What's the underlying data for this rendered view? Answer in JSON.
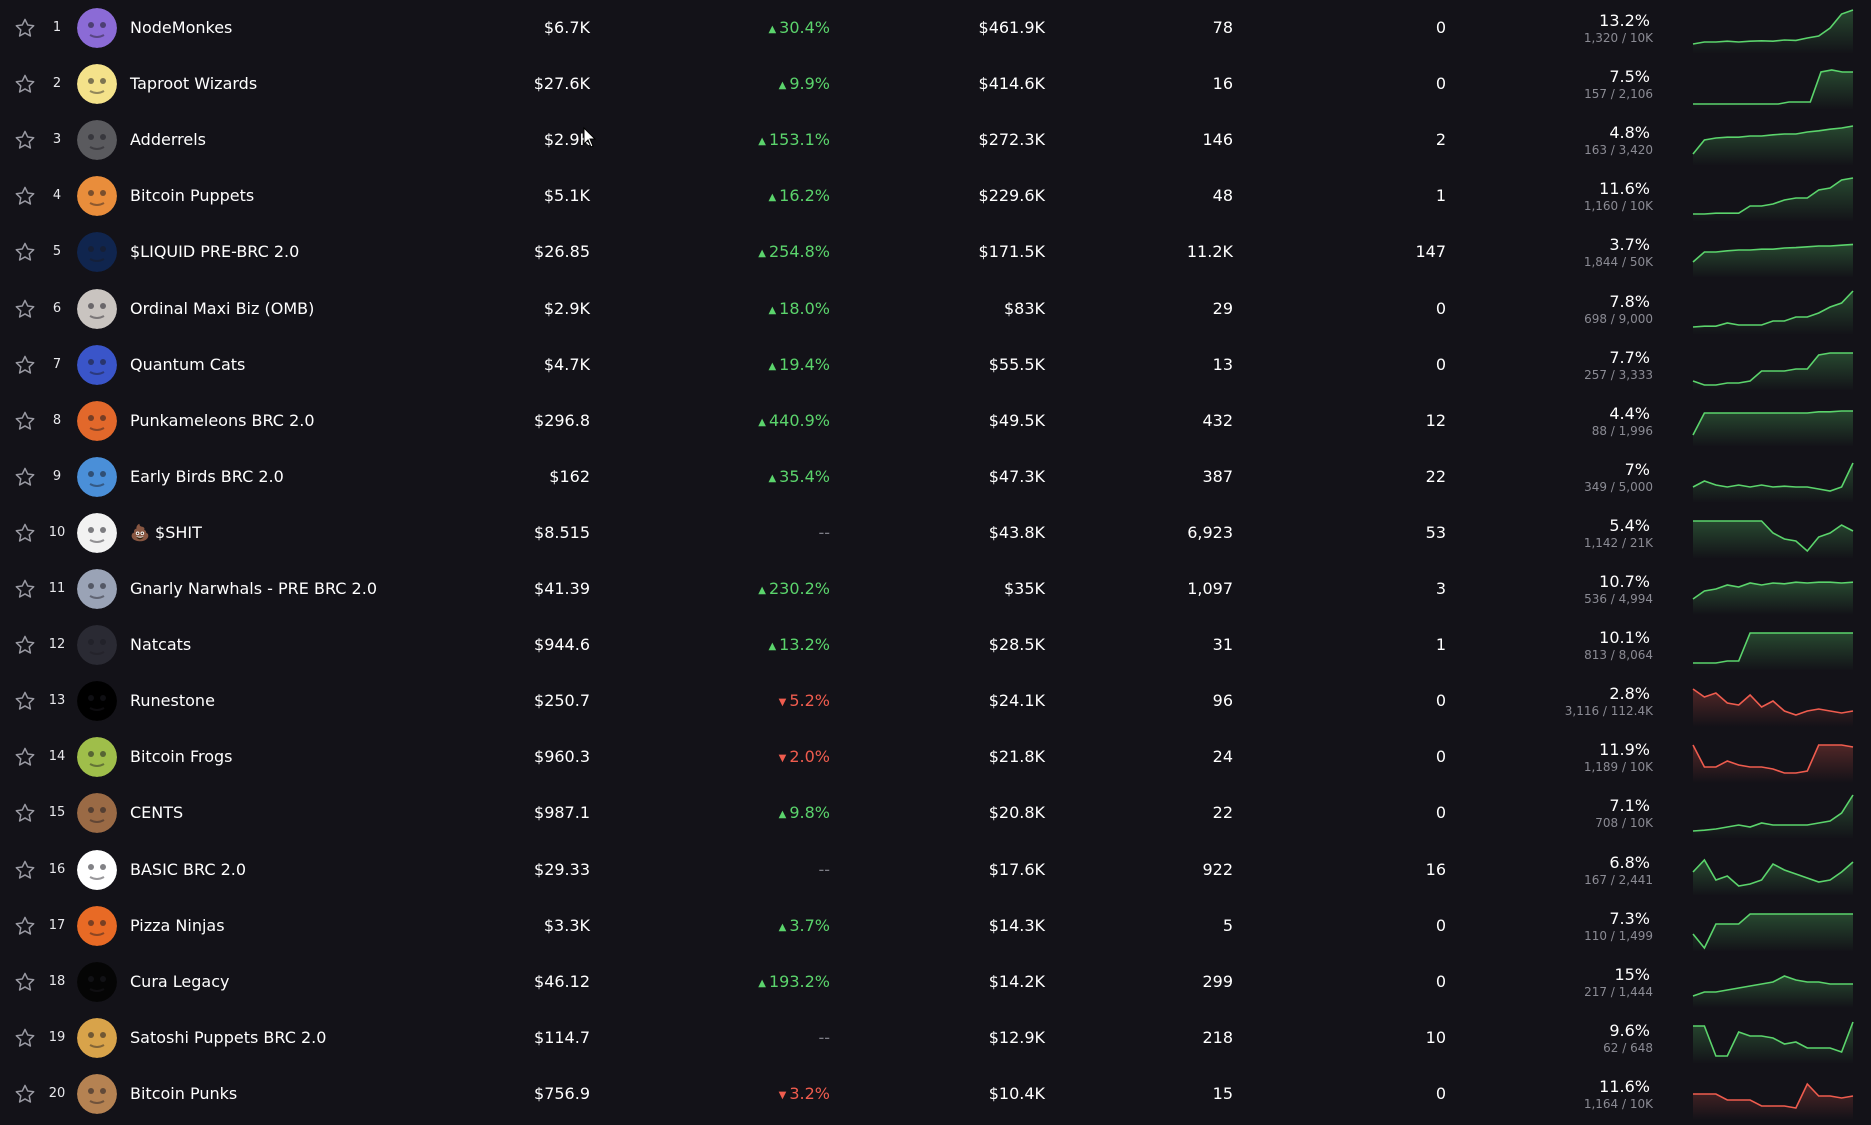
{
  "colors": {
    "background": "#131218",
    "positive": "#5bd46c",
    "negative": "#ef5c4e",
    "neutral": "#7d7d86",
    "muted_text": "#8b8b94"
  },
  "icons": {
    "favorite": "star-outline-icon",
    "change_up": "triangle-up-icon",
    "change_down": "triangle-down-icon",
    "cursor": "mouse-pointer-icon"
  },
  "rows": [
    {
      "rank": "1",
      "name": "NodeMonkes",
      "price": "$6.7K",
      "change": "30.4%",
      "dir": "up",
      "volume": "$461.9K",
      "sales": "78",
      "listed": "0",
      "pct": "13.2%",
      "pct_sub": "1,320 / 10K",
      "avatar": "#8b6bd6",
      "spark": [
        0.15,
        0.2,
        0.2,
        0.22,
        0.2,
        0.22,
        0.23,
        0.22,
        0.25,
        0.24,
        0.3,
        0.35,
        0.55,
        0.9,
        1.0
      ],
      "spark_dir": "up"
    },
    {
      "rank": "2",
      "name": "Taproot Wizards",
      "price": "$27.6K",
      "change": "9.9%",
      "dir": "up",
      "volume": "$414.6K",
      "sales": "16",
      "listed": "0",
      "pct": "7.5%",
      "pct_sub": "157 / 2,106",
      "avatar": "#f4e28a",
      "spark": [
        0.05,
        0.05,
        0.05,
        0.05,
        0.05,
        0.05,
        0.05,
        0.05,
        0.05,
        0.1,
        0.1,
        0.1,
        0.85,
        0.9,
        0.85,
        0.85
      ],
      "spark_dir": "up"
    },
    {
      "rank": "3",
      "name": "Adderrels",
      "price": "$2.9K",
      "change": "153.1%",
      "dir": "up",
      "volume": "$272.3K",
      "sales": "146",
      "listed": "2",
      "pct": "4.8%",
      "pct_sub": "163 / 3,420",
      "avatar": "#5a5a5e",
      "spark": [
        0.2,
        0.55,
        0.6,
        0.62,
        0.62,
        0.65,
        0.65,
        0.68,
        0.7,
        0.7,
        0.75,
        0.78,
        0.82,
        0.85,
        0.9
      ],
      "spark_dir": "up"
    },
    {
      "rank": "4",
      "name": "Bitcoin Puppets",
      "price": "$5.1K",
      "change": "16.2%",
      "dir": "up",
      "volume": "$229.6K",
      "sales": "48",
      "listed": "1",
      "pct": "11.6%",
      "pct_sub": "1,160 / 10K",
      "avatar": "#e98d3b",
      "spark": [
        0.1,
        0.1,
        0.12,
        0.12,
        0.12,
        0.3,
        0.3,
        0.35,
        0.45,
        0.5,
        0.5,
        0.7,
        0.75,
        0.95,
        1.0
      ],
      "spark_dir": "up"
    },
    {
      "rank": "5",
      "name": "$LIQUID PRE-BRC 2.0",
      "price": "$26.85",
      "change": "254.8%",
      "dir": "up",
      "volume": "$171.5K",
      "sales": "11.2K",
      "listed": "147",
      "pct": "3.7%",
      "pct_sub": "1,844 / 50K",
      "avatar": "#10254e",
      "spark": [
        0.3,
        0.55,
        0.55,
        0.58,
        0.6,
        0.6,
        0.62,
        0.62,
        0.65,
        0.66,
        0.68,
        0.7,
        0.7,
        0.72,
        0.74
      ],
      "spark_dir": "up"
    },
    {
      "rank": "6",
      "name": "Ordinal Maxi Biz (OMB)",
      "price": "$2.9K",
      "change": "18.0%",
      "dir": "up",
      "volume": "$83K",
      "sales": "29",
      "listed": "0",
      "pct": "7.8%",
      "pct_sub": "698 / 9,000",
      "avatar": "#c9c4c0",
      "spark": [
        0.1,
        0.12,
        0.12,
        0.2,
        0.15,
        0.15,
        0.15,
        0.25,
        0.25,
        0.35,
        0.35,
        0.45,
        0.6,
        0.7,
        1.0
      ],
      "spark_dir": "up"
    },
    {
      "rank": "7",
      "name": "Quantum Cats",
      "price": "$4.7K",
      "change": "19.4%",
      "dir": "up",
      "volume": "$55.5K",
      "sales": "13",
      "listed": "0",
      "pct": "7.7%",
      "pct_sub": "257 / 3,333",
      "avatar": "#3a55c9",
      "spark": [
        0.15,
        0.05,
        0.05,
        0.1,
        0.1,
        0.15,
        0.4,
        0.4,
        0.4,
        0.45,
        0.45,
        0.8,
        0.85,
        0.85,
        0.85
      ],
      "spark_dir": "up"
    },
    {
      "rank": "8",
      "name": "Punkameleons BRC 2.0",
      "price": "$296.8",
      "change": "440.9%",
      "dir": "up",
      "volume": "$49.5K",
      "sales": "432",
      "listed": "12",
      "pct": "4.4%",
      "pct_sub": "88 / 1,996",
      "avatar": "#e2682b",
      "spark": [
        0.2,
        0.75,
        0.75,
        0.75,
        0.75,
        0.75,
        0.75,
        0.75,
        0.75,
        0.75,
        0.75,
        0.78,
        0.78,
        0.8,
        0.8
      ],
      "spark_dir": "up"
    },
    {
      "rank": "9",
      "name": "Early Birds BRC 2.0",
      "price": "$162",
      "change": "35.4%",
      "dir": "up",
      "volume": "$47.3K",
      "sales": "387",
      "listed": "22",
      "pct": "7%",
      "pct_sub": "349 / 5,000",
      "avatar": "#4a8fd8",
      "spark": [
        0.3,
        0.45,
        0.35,
        0.3,
        0.35,
        0.3,
        0.35,
        0.3,
        0.32,
        0.3,
        0.3,
        0.25,
        0.2,
        0.3,
        0.9
      ],
      "spark_dir": "up"
    },
    {
      "rank": "10",
      "name": "💩 $SHIT",
      "price": "$8.515",
      "change": "--",
      "dir": "flat",
      "volume": "$43.8K",
      "sales": "6,923",
      "listed": "53",
      "pct": "5.4%",
      "pct_sub": "1,142 / 21K",
      "avatar": "#f2f2f2",
      "spark": [
        0.85,
        0.85,
        0.85,
        0.85,
        0.85,
        0.85,
        0.85,
        0.55,
        0.4,
        0.35,
        0.1,
        0.45,
        0.55,
        0.75,
        0.6
      ],
      "spark_dir": "up"
    },
    {
      "rank": "11",
      "name": "Gnarly Narwhals - PRE BRC 2.0",
      "price": "$41.39",
      "change": "230.2%",
      "dir": "up",
      "volume": "$35K",
      "sales": "1,097",
      "listed": "3",
      "pct": "10.7%",
      "pct_sub": "536 / 4,994",
      "avatar": "#9aa3b6",
      "spark": [
        0.3,
        0.5,
        0.55,
        0.65,
        0.6,
        0.7,
        0.65,
        0.7,
        0.68,
        0.72,
        0.7,
        0.72,
        0.72,
        0.7,
        0.72
      ],
      "spark_dir": "up"
    },
    {
      "rank": "12",
      "name": "Natcats",
      "price": "$944.6",
      "change": "13.2%",
      "dir": "up",
      "volume": "$28.5K",
      "sales": "31",
      "listed": "1",
      "pct": "10.1%",
      "pct_sub": "813 / 8,064",
      "avatar": "#2a2a33",
      "spark": [
        0.1,
        0.1,
        0.1,
        0.15,
        0.15,
        0.85,
        0.85,
        0.85,
        0.85,
        0.85,
        0.85,
        0.85,
        0.85,
        0.85,
        0.85
      ],
      "spark_dir": "up"
    },
    {
      "rank": "13",
      "name": "Runestone",
      "price": "$250.7",
      "change": "5.2%",
      "dir": "down",
      "volume": "$24.1K",
      "sales": "96",
      "listed": "0",
      "pct": "2.8%",
      "pct_sub": "3,116 / 112.4K",
      "avatar": "#000000",
      "spark": [
        0.85,
        0.65,
        0.75,
        0.5,
        0.45,
        0.7,
        0.4,
        0.55,
        0.3,
        0.2,
        0.3,
        0.35,
        0.3,
        0.25,
        0.3
      ],
      "spark_dir": "down"
    },
    {
      "rank": "14",
      "name": "Bitcoin Frogs",
      "price": "$960.3",
      "change": "2.0%",
      "dir": "down",
      "volume": "$21.8K",
      "sales": "24",
      "listed": "0",
      "pct": "11.9%",
      "pct_sub": "1,189 / 10K",
      "avatar": "#9fbe4a",
      "spark": [
        0.85,
        0.3,
        0.3,
        0.45,
        0.35,
        0.3,
        0.3,
        0.25,
        0.15,
        0.15,
        0.2,
        0.85,
        0.85,
        0.85,
        0.8
      ],
      "spark_dir": "down"
    },
    {
      "rank": "15",
      "name": "CENTS",
      "price": "$987.1",
      "change": "9.8%",
      "dir": "up",
      "volume": "$20.8K",
      "sales": "22",
      "listed": "0",
      "pct": "7.1%",
      "pct_sub": "708 / 10K",
      "avatar": "#9a6a45",
      "spark": [
        0.1,
        0.12,
        0.15,
        0.2,
        0.25,
        0.2,
        0.3,
        0.25,
        0.25,
        0.25,
        0.25,
        0.3,
        0.35,
        0.55,
        1.0
      ],
      "spark_dir": "up"
    },
    {
      "rank": "16",
      "name": "BASIC BRC 2.0",
      "price": "$29.33",
      "change": "--",
      "dir": "flat",
      "volume": "$17.6K",
      "sales": "922",
      "listed": "16",
      "pct": "6.8%",
      "pct_sub": "167 / 2,441",
      "avatar": "#ffffff",
      "spark": [
        0.5,
        0.8,
        0.3,
        0.4,
        0.15,
        0.2,
        0.3,
        0.7,
        0.55,
        0.45,
        0.35,
        0.25,
        0.3,
        0.5,
        0.75
      ],
      "spark_dir": "up"
    },
    {
      "rank": "17",
      "name": "Pizza Ninjas",
      "price": "$3.3K",
      "change": "3.7%",
      "dir": "up",
      "volume": "$14.3K",
      "sales": "5",
      "listed": "0",
      "pct": "7.3%",
      "pct_sub": "110 / 1,499",
      "avatar": "#e86a25",
      "spark": [
        0.35,
        0.0,
        0.6,
        0.6,
        0.6,
        0.85,
        0.85,
        0.85,
        0.85,
        0.85,
        0.85,
        0.85,
        0.85,
        0.85,
        0.85
      ],
      "spark_dir": "up"
    },
    {
      "rank": "18",
      "name": "Cura Legacy",
      "price": "$46.12",
      "change": "193.2%",
      "dir": "up",
      "volume": "$14.2K",
      "sales": "299",
      "listed": "0",
      "pct": "15%",
      "pct_sub": "217 / 1,444",
      "avatar": "#050505",
      "spark": [
        0.2,
        0.3,
        0.3,
        0.35,
        0.4,
        0.45,
        0.5,
        0.55,
        0.7,
        0.6,
        0.55,
        0.55,
        0.5,
        0.5,
        0.5
      ],
      "spark_dir": "up"
    },
    {
      "rank": "19",
      "name": "Satoshi Puppets BRC 2.0",
      "price": "$114.7",
      "change": "--",
      "dir": "flat",
      "volume": "$12.9K",
      "sales": "218",
      "listed": "10",
      "pct": "9.6%",
      "pct_sub": "62 / 648",
      "avatar": "#d8a34a",
      "spark": [
        0.85,
        0.85,
        0.1,
        0.1,
        0.7,
        0.6,
        0.6,
        0.55,
        0.4,
        0.45,
        0.3,
        0.3,
        0.3,
        0.2,
        0.95
      ],
      "spark_dir": "up"
    },
    {
      "rank": "20",
      "name": "Bitcoin Punks",
      "price": "$756.9",
      "change": "3.2%",
      "dir": "down",
      "volume": "$10.4K",
      "sales": "15",
      "listed": "0",
      "pct": "11.6%",
      "pct_sub": "1,164 / 10K",
      "avatar": "#b58252",
      "spark": [
        0.55,
        0.55,
        0.55,
        0.4,
        0.4,
        0.4,
        0.25,
        0.25,
        0.25,
        0.2,
        0.8,
        0.5,
        0.5,
        0.45,
        0.5
      ],
      "spark_dir": "down"
    }
  ]
}
